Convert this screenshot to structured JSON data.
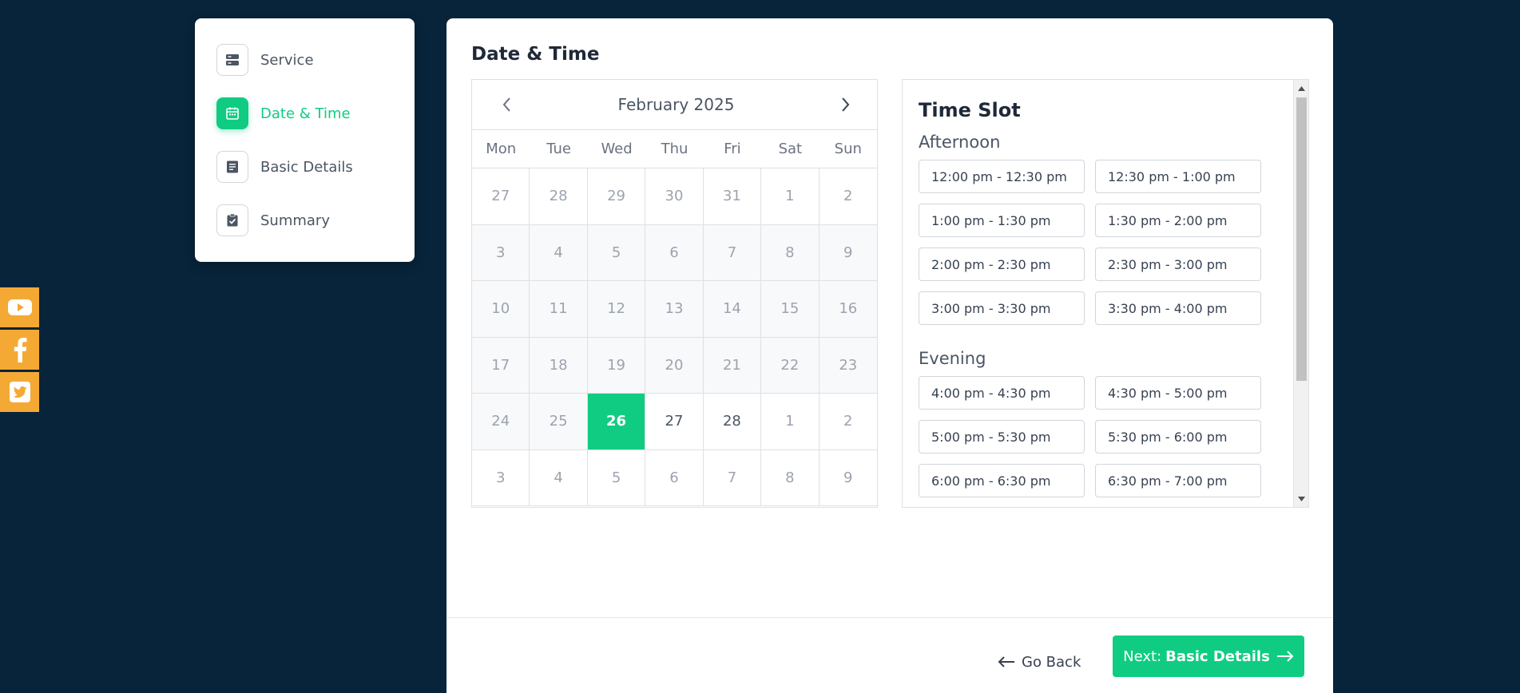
{
  "social": [
    {
      "name": "youtube-icon"
    },
    {
      "name": "facebook-icon"
    },
    {
      "name": "twitter-icon"
    }
  ],
  "steps": [
    {
      "label": "Service",
      "icon": "server-icon",
      "active": false
    },
    {
      "label": "Date & Time",
      "icon": "calendar-icon",
      "active": true
    },
    {
      "label": "Basic Details",
      "icon": "document-icon",
      "active": false
    },
    {
      "label": "Summary",
      "icon": "clipboard-check-icon",
      "active": false
    }
  ],
  "main": {
    "title": "Date & Time"
  },
  "calendar": {
    "month": "February 2025",
    "weekdays": [
      "Mon",
      "Tue",
      "Wed",
      "Thu",
      "Fri",
      "Sat",
      "Sun"
    ],
    "days": [
      {
        "n": "27",
        "s": "out"
      },
      {
        "n": "28",
        "s": "out"
      },
      {
        "n": "29",
        "s": "out"
      },
      {
        "n": "30",
        "s": "out"
      },
      {
        "n": "31",
        "s": "out"
      },
      {
        "n": "1",
        "s": "out"
      },
      {
        "n": "2",
        "s": "out"
      },
      {
        "n": "3",
        "s": "dis"
      },
      {
        "n": "4",
        "s": "dis"
      },
      {
        "n": "5",
        "s": "dis"
      },
      {
        "n": "6",
        "s": "dis"
      },
      {
        "n": "7",
        "s": "dis"
      },
      {
        "n": "8",
        "s": "dis"
      },
      {
        "n": "9",
        "s": "dis"
      },
      {
        "n": "10",
        "s": "dis"
      },
      {
        "n": "11",
        "s": "dis"
      },
      {
        "n": "12",
        "s": "dis"
      },
      {
        "n": "13",
        "s": "dis"
      },
      {
        "n": "14",
        "s": "dis"
      },
      {
        "n": "15",
        "s": "dis"
      },
      {
        "n": "16",
        "s": "dis"
      },
      {
        "n": "17",
        "s": "dis"
      },
      {
        "n": "18",
        "s": "dis"
      },
      {
        "n": "19",
        "s": "dis"
      },
      {
        "n": "20",
        "s": "dis"
      },
      {
        "n": "21",
        "s": "dis"
      },
      {
        "n": "22",
        "s": "dis"
      },
      {
        "n": "23",
        "s": "dis"
      },
      {
        "n": "24",
        "s": "dis"
      },
      {
        "n": "25",
        "s": "dis"
      },
      {
        "n": "26",
        "s": "selected"
      },
      {
        "n": "27",
        "s": "avail"
      },
      {
        "n": "28",
        "s": "avail"
      },
      {
        "n": "1",
        "s": "out"
      },
      {
        "n": "2",
        "s": "out"
      },
      {
        "n": "3",
        "s": "out"
      },
      {
        "n": "4",
        "s": "out"
      },
      {
        "n": "5",
        "s": "out"
      },
      {
        "n": "6",
        "s": "out"
      },
      {
        "n": "7",
        "s": "out"
      },
      {
        "n": "8",
        "s": "out"
      },
      {
        "n": "9",
        "s": "out"
      }
    ]
  },
  "time_slots": {
    "title": "Time Slot",
    "groups": [
      {
        "name": "Afternoon",
        "slots": [
          "12:00 pm - 12:30 pm",
          "12:30 pm - 1:00 pm",
          "1:00 pm - 1:30 pm",
          "1:30 pm - 2:00 pm",
          "2:00 pm - 2:30 pm",
          "2:30 pm - 3:00 pm",
          "3:00 pm - 3:30 pm",
          "3:30 pm - 4:00 pm"
        ]
      },
      {
        "name": "Evening",
        "slots": [
          "4:00 pm - 4:30 pm",
          "4:30 pm - 5:00 pm",
          "5:00 pm - 5:30 pm",
          "5:30 pm - 6:00 pm",
          "6:00 pm - 6:30 pm",
          "6:30 pm - 7:00 pm"
        ]
      }
    ]
  },
  "footer": {
    "back_label": "Go Back",
    "next_prefix": "Next:",
    "next_label": "Basic Details"
  },
  "colors": {
    "accent": "#10cc82",
    "background": "#08243a",
    "social": "#f5a935"
  }
}
